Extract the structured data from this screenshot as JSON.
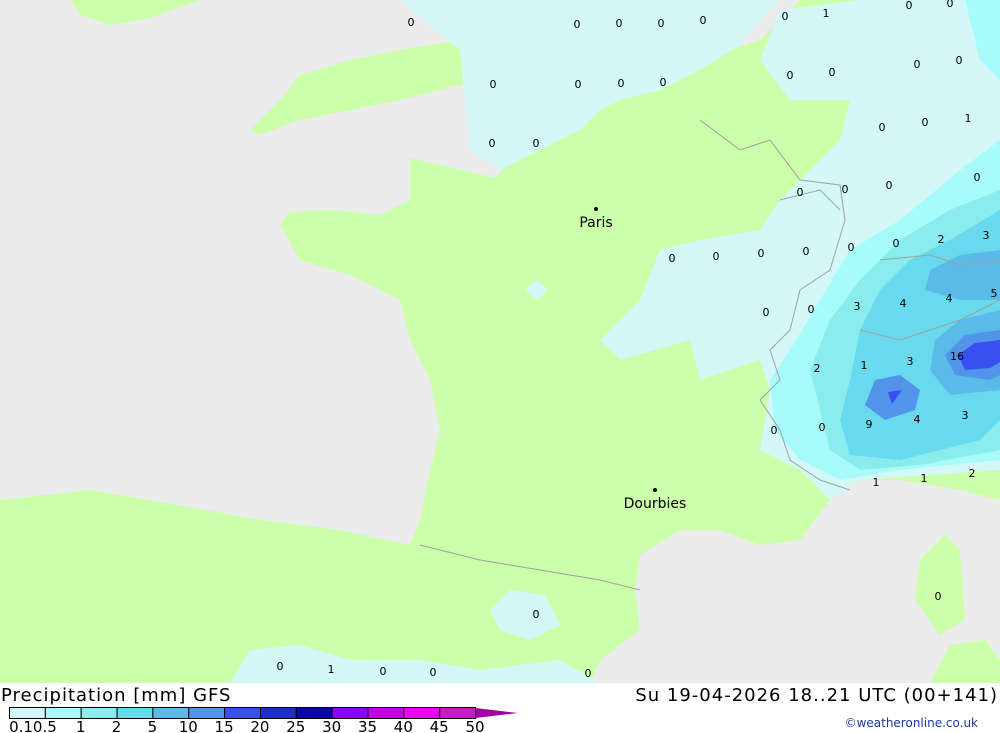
{
  "map": {
    "cities": [
      {
        "name": "Paris"
      },
      {
        "name": "Dourbies"
      }
    ],
    "value_labels": [
      "0",
      "0",
      "0",
      "0",
      "0",
      "0",
      "1",
      "0",
      "0",
      "0",
      "0",
      "0",
      "0",
      "0",
      "0",
      "0",
      "0",
      "0",
      "0",
      "0",
      "0",
      "1",
      "0",
      "0",
      "0",
      "0",
      "0",
      "0",
      "0",
      "0",
      "0",
      "0",
      "2",
      "3",
      "0",
      "0",
      "3",
      "4",
      "4",
      "5",
      "2",
      "1",
      "3",
      "16",
      "0",
      "0",
      "9",
      "4",
      "3",
      "1",
      "1",
      "2",
      "0",
      "0",
      "0",
      "1",
      "0",
      "0",
      "0"
    ],
    "colors": {
      "sea": "#ececec",
      "land": "#ccffaa",
      "border": "#a0a0a0"
    }
  },
  "legend": {
    "title": "Precipitation [mm] GFS",
    "datetime": "Su 19-04-2026 18..21 UTC (00+141)",
    "copyright": "©weatheronline.co.uk",
    "ticks": [
      "0.1",
      "0.5",
      "1",
      "2",
      "5",
      "10",
      "15",
      "20",
      "25",
      "30",
      "35",
      "40",
      "45",
      "50"
    ],
    "colors": [
      "#d4f8f8",
      "#a8fbfb",
      "#8aecec",
      "#69d9ed",
      "#5abbe9",
      "#5294e9",
      "#3a4ff0",
      "#1d2fc0",
      "#0b0a9e",
      "#8c00ff",
      "#c000e6",
      "#f000f0",
      "#c020c0",
      "#a000a0"
    ]
  }
}
